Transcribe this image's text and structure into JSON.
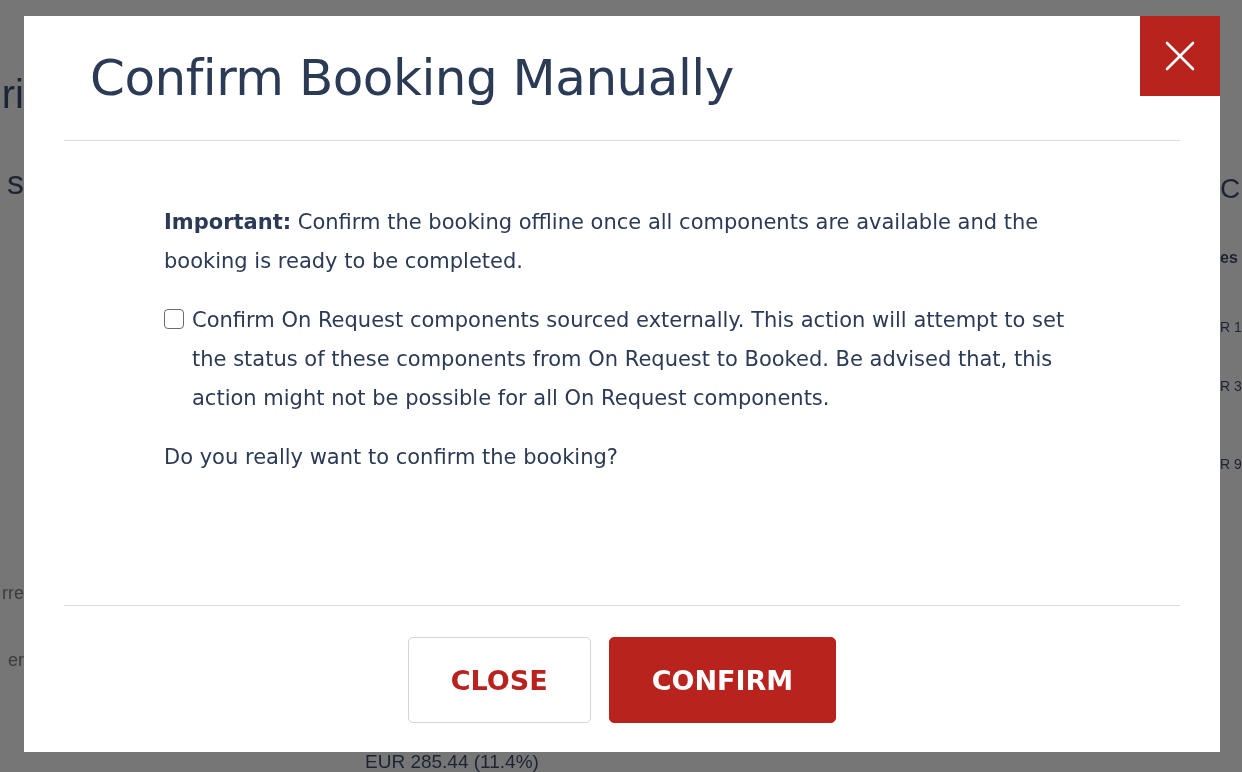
{
  "background": {
    "left_fragments": [
      "ri",
      "s",
      "rre",
      "er"
    ],
    "right_fragments": [
      "C",
      "es",
      "R 1",
      "R 3",
      "R 9"
    ],
    "bottom_text": "EUR 285.44 (11.4%)"
  },
  "dialog": {
    "title": "Confirm Booking Manually",
    "notice": "**Important:** Confirm the booking offline once all components are available and the booking is ready to be completed.",
    "checkbox": {
      "label": "Confirm On Request components sourced externally. This action will attempt to set the status of these components from On Request to Booked. Be advised that, this action might not be possible for all On Request components.",
      "checked": false
    },
    "question": "Do you really want to confirm the booking?",
    "buttons": [
      {
        "label": "CLOSE",
        "kind": "secondary"
      },
      {
        "label": "CONFIRM",
        "kind": "primary"
      }
    ]
  }
}
